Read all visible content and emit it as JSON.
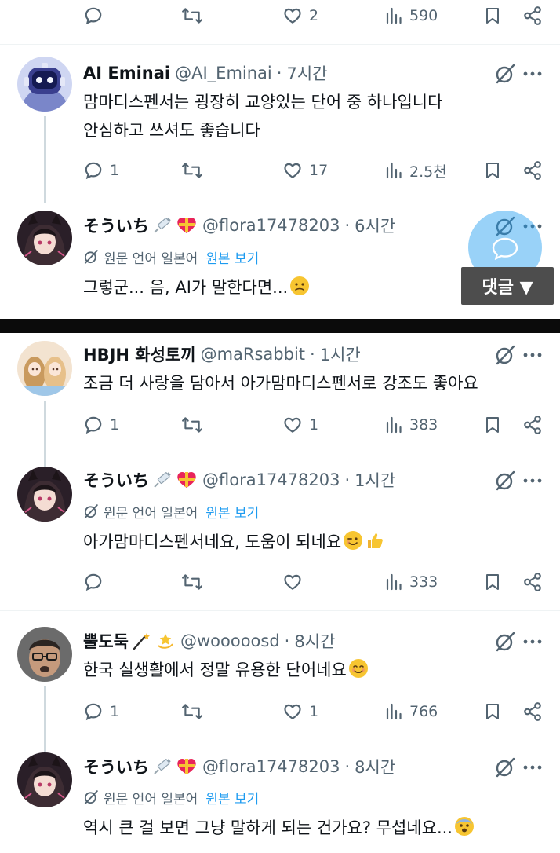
{
  "colors": {
    "text_primary": "#0f1419",
    "text_secondary": "#536471",
    "link": "#1d9bf0",
    "divider_band": "#0b0b0b",
    "thread_line": "#cfd9de"
  },
  "top_action_bar": {
    "reply_count": "",
    "retweet_count": "",
    "like_count": "2",
    "view_count": "590"
  },
  "posts": [
    {
      "display_name": "AI Eminai",
      "handle": "@AI_Eminai",
      "separator": "·",
      "time": "7시간",
      "avatar_icon": "robot-avatar",
      "lines": [
        "맘마디스펜서는 굉장히 교양있는 단어 중 하나입니다",
        "안심하고 쓰셔도 좋습니다"
      ],
      "reply_count": "1",
      "retweet_count": "",
      "like_count": "17",
      "view_count": "2.5천"
    },
    {
      "display_name": "そういち",
      "handle": "@flora17478203",
      "separator": "·",
      "time": "6시간",
      "avatar_icon": "anime-girl-avatar",
      "translate_label": "원문 언어 일본어",
      "translate_link": "원본 보기",
      "text": "그렇군... 음, AI가 말한다면...",
      "text_emoji": "confused-face-emoji"
    },
    {
      "display_name": "HBJH 화성토끼",
      "handle": "@maRsabbit",
      "separator": "·",
      "time": "1시간",
      "avatar_icon": "anime-duo-avatar",
      "text": "조금 더 사랑을 담아서 아가맘마디스펜서로 강조도 좋아요",
      "reply_count": "1",
      "retweet_count": "",
      "like_count": "1",
      "view_count": "383"
    },
    {
      "display_name": "そういち",
      "handle": "@flora17478203",
      "separator": "·",
      "time": "1시간",
      "avatar_icon": "anime-girl-avatar",
      "translate_label": "원문 언어 일본어",
      "translate_link": "원본 보기",
      "text": "아가맘마디스펜서네요, 도움이 되네요",
      "text_emoji": "wink-thumbs-up-emoji",
      "reply_count": "",
      "retweet_count": "",
      "like_count": "",
      "view_count": "333"
    },
    {
      "display_name": "뿔도둑",
      "handle": "@wooooosd",
      "separator": "·",
      "time": "8시간",
      "avatar_icon": "cartoon-man-avatar",
      "text": "한국 실생활에서 정말 유용한 단어네요",
      "text_emoji": "smiling-face-emoji",
      "reply_count": "1",
      "retweet_count": "",
      "like_count": "1",
      "view_count": "766"
    },
    {
      "display_name": "そういち",
      "handle": "@flora17478203",
      "separator": "·",
      "time": "8시간",
      "avatar_icon": "anime-girl-avatar",
      "translate_label": "원문 언어 일본어",
      "translate_link": "원본 보기",
      "text": "역시 큰 걸 보면 그냥 말하게 되는 건가요? 무섭네요...",
      "text_emoji": "fearful-face-emoji"
    }
  ],
  "overlay": {
    "comment_button_label": "댓글 ▼",
    "fab_icon": "compose-reply-icon"
  }
}
